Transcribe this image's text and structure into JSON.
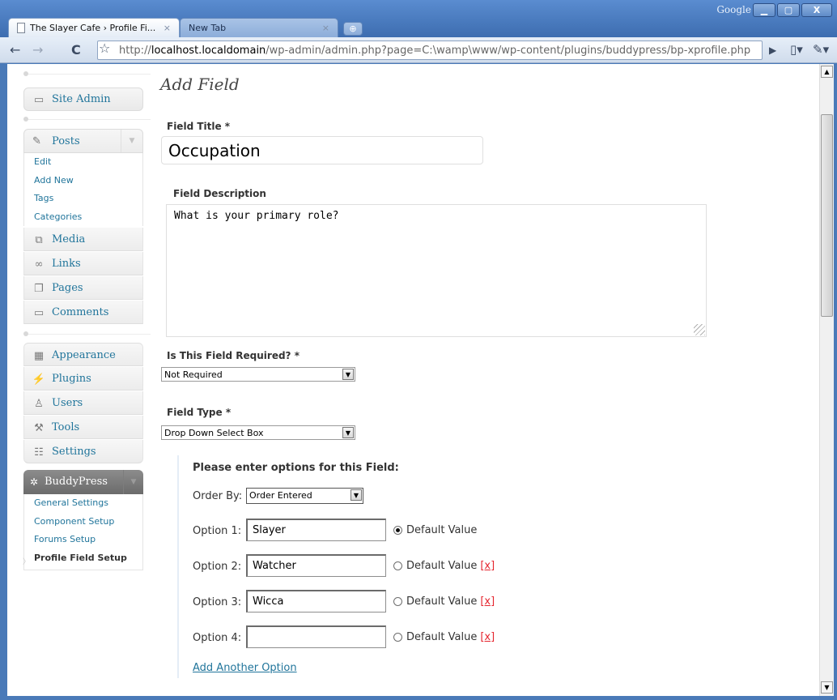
{
  "browser": {
    "brand": "Google",
    "tabs": [
      {
        "label": "The Slayer Cafe › Profile Fi...",
        "close": "×"
      },
      {
        "label": "New Tab",
        "close": "×"
      }
    ],
    "url_prefix": "http://",
    "url_host": "localhost.localdomain",
    "url_path": "/wp-admin/admin.php?page=C:\\wamp\\www/wp-content/plugins/buddypress/bp-xprofile.php"
  },
  "sidebar": {
    "site_admin": "Site Admin",
    "posts": {
      "label": "Posts",
      "items": [
        "Edit",
        "Add New",
        "Tags",
        "Categories"
      ]
    },
    "group1": [
      "Media",
      "Links",
      "Pages",
      "Comments"
    ],
    "group2": [
      "Appearance",
      "Plugins",
      "Users",
      "Tools",
      "Settings"
    ],
    "buddypress": {
      "label": "BuddyPress",
      "items": [
        "General Settings",
        "Component Setup",
        "Forums Setup",
        "Profile Field Setup"
      ]
    }
  },
  "form": {
    "title": "Add Field",
    "field_title_label": "Field Title *",
    "field_title_value": "Occupation",
    "field_description_label": "Field Description",
    "field_description_value": "What is your primary role?",
    "required_label": "Is This Field Required? *",
    "required_value": "Not Required",
    "type_label": "Field Type *",
    "type_value": "Drop Down Select Box",
    "options_heading": "Please enter options for this Field:",
    "order_by_label": "Order By:",
    "order_by_value": "Order Entered",
    "options": [
      {
        "label": "Option 1:",
        "value": "Slayer",
        "default": "Default Value",
        "checked": true,
        "delete": ""
      },
      {
        "label": "Option 2:",
        "value": "Watcher",
        "default": "Default Value",
        "checked": false,
        "delete": "[x]"
      },
      {
        "label": "Option 3:",
        "value": "Wicca",
        "default": "Default Value",
        "checked": false,
        "delete": "[x]"
      },
      {
        "label": "Option 4:",
        "value": "",
        "default": "Default Value",
        "checked": false,
        "delete": "[x]"
      }
    ],
    "add_option": "Add Another Option"
  },
  "colors": {
    "link": "#21759b",
    "delete": "#e5262f"
  }
}
